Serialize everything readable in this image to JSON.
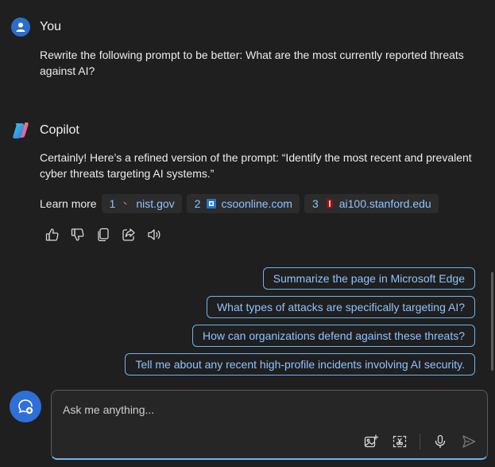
{
  "user": {
    "name": "You",
    "message": "Rewrite the following prompt to be better: What are the most currently reported threats against AI?"
  },
  "copilot": {
    "name": "Copilot",
    "message": "Certainly! Here’s a refined version of the prompt: “Identify the most recent and prevalent cyber threats targeting AI systems.”",
    "learn_more_label": "Learn more",
    "sources": [
      {
        "num": "1",
        "host": "nist.gov",
        "icon": "nist-favicon"
      },
      {
        "num": "2",
        "host": "csoonline.com",
        "icon": "csoonline-favicon"
      },
      {
        "num": "3",
        "host": "ai100.stanford.edu",
        "icon": "stanford-favicon"
      }
    ],
    "actions": [
      "thumbs-up-icon",
      "thumbs-down-icon",
      "copy-icon",
      "share-icon",
      "read-aloud-icon"
    ]
  },
  "suggestions": [
    "Summarize the page in Microsoft Edge",
    "What types of attacks are specifically targeting AI?",
    "How can organizations defend against these threats?",
    "Tell me about any recent high-profile incidents involving AI security."
  ],
  "composer": {
    "placeholder": "Ask me anything...",
    "tools": [
      "add-image-icon",
      "screenshot-icon",
      "microphone-icon",
      "send-icon"
    ]
  },
  "colors": {
    "background": "#1f1f1f",
    "accent": "#8ec4ff",
    "accent_border": "#6fb2ef",
    "new_topic_button": "#2f6fd8"
  }
}
